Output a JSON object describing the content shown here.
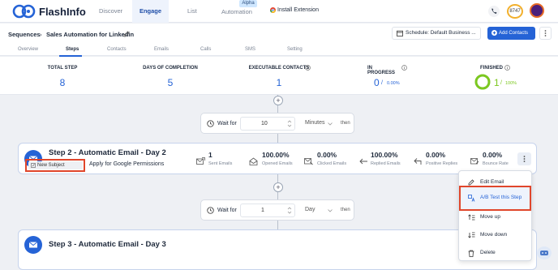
{
  "app": {
    "name": "FlashInfo"
  },
  "nav": {
    "discover": "Discover",
    "engage": "Engage",
    "list": "List",
    "automation": "Automation",
    "alpha_badge": "Alpha",
    "install_extension": "Install Extension",
    "credits": "8747"
  },
  "header": {
    "breadcrumb_root": "Sequences",
    "separator": "›",
    "title": "Sales Automation for Linkedin",
    "schedule": "Schedule: Default Business ...",
    "add_contacts": "Add Contacts"
  },
  "tabs": [
    {
      "label": "Overview",
      "active": false
    },
    {
      "label": "Steps",
      "active": true
    },
    {
      "label": "Contacts",
      "active": false
    },
    {
      "label": "Emails",
      "active": false
    },
    {
      "label": "Calls",
      "active": false
    },
    {
      "label": "SMS",
      "active": false
    },
    {
      "label": "Setting",
      "active": false
    }
  ],
  "stats": {
    "total_step": {
      "label": "TOTAL STEP",
      "value": "8"
    },
    "days_of_completion": {
      "label": "DAYS OF COMPLETION",
      "value": "5"
    },
    "executable_contacts": {
      "label": "EXECUTABLE CONTACTS",
      "value": "1"
    },
    "in_progress": {
      "label": "IN PROGRESS",
      "value": "0",
      "sep": "/",
      "pct": "0.00%"
    },
    "finished": {
      "label": "FINISHED",
      "value": "1",
      "sep": "/",
      "pct": "100%",
      "progress": 1.0
    }
  },
  "wait1": {
    "label": "Wait for",
    "value": "10",
    "unit": "Minutes",
    "then": "then"
  },
  "wait2": {
    "label": "Wait for",
    "value": "1",
    "unit": "Day",
    "then": "then"
  },
  "step2": {
    "title": "Step 2 - Automatic Email - Day 2",
    "subject_button": "New Subject",
    "subject": "Apply for Google Permissions",
    "metrics": [
      {
        "value": "1",
        "label": "Sent Emails",
        "icon": "send-icon"
      },
      {
        "value": "100.00%",
        "label": "Opened Emails",
        "icon": "open-mail-icon"
      },
      {
        "value": "0.00%",
        "label": "Clicked Emails",
        "icon": "click-mail-icon"
      },
      {
        "value": "100.00%",
        "label": "Replied Emails",
        "icon": "reply-icon"
      },
      {
        "value": "0.00%",
        "label": "Positive Replies",
        "icon": "positive-reply-icon"
      },
      {
        "value": "0.00%",
        "label": "Bounce Rate",
        "icon": "bounce-icon"
      }
    ]
  },
  "step3": {
    "title": "Step 3 - Automatic Email - Day 3"
  },
  "menu": {
    "edit_email": "Edit Email",
    "ab_test": "A/B Test this Step",
    "move_up": "Move up",
    "move_down": "Move down",
    "delete": "Delete"
  },
  "colors": {
    "primary": "#2563d6",
    "highlight": "#e0462b",
    "finished_ring": "#7cc820"
  }
}
